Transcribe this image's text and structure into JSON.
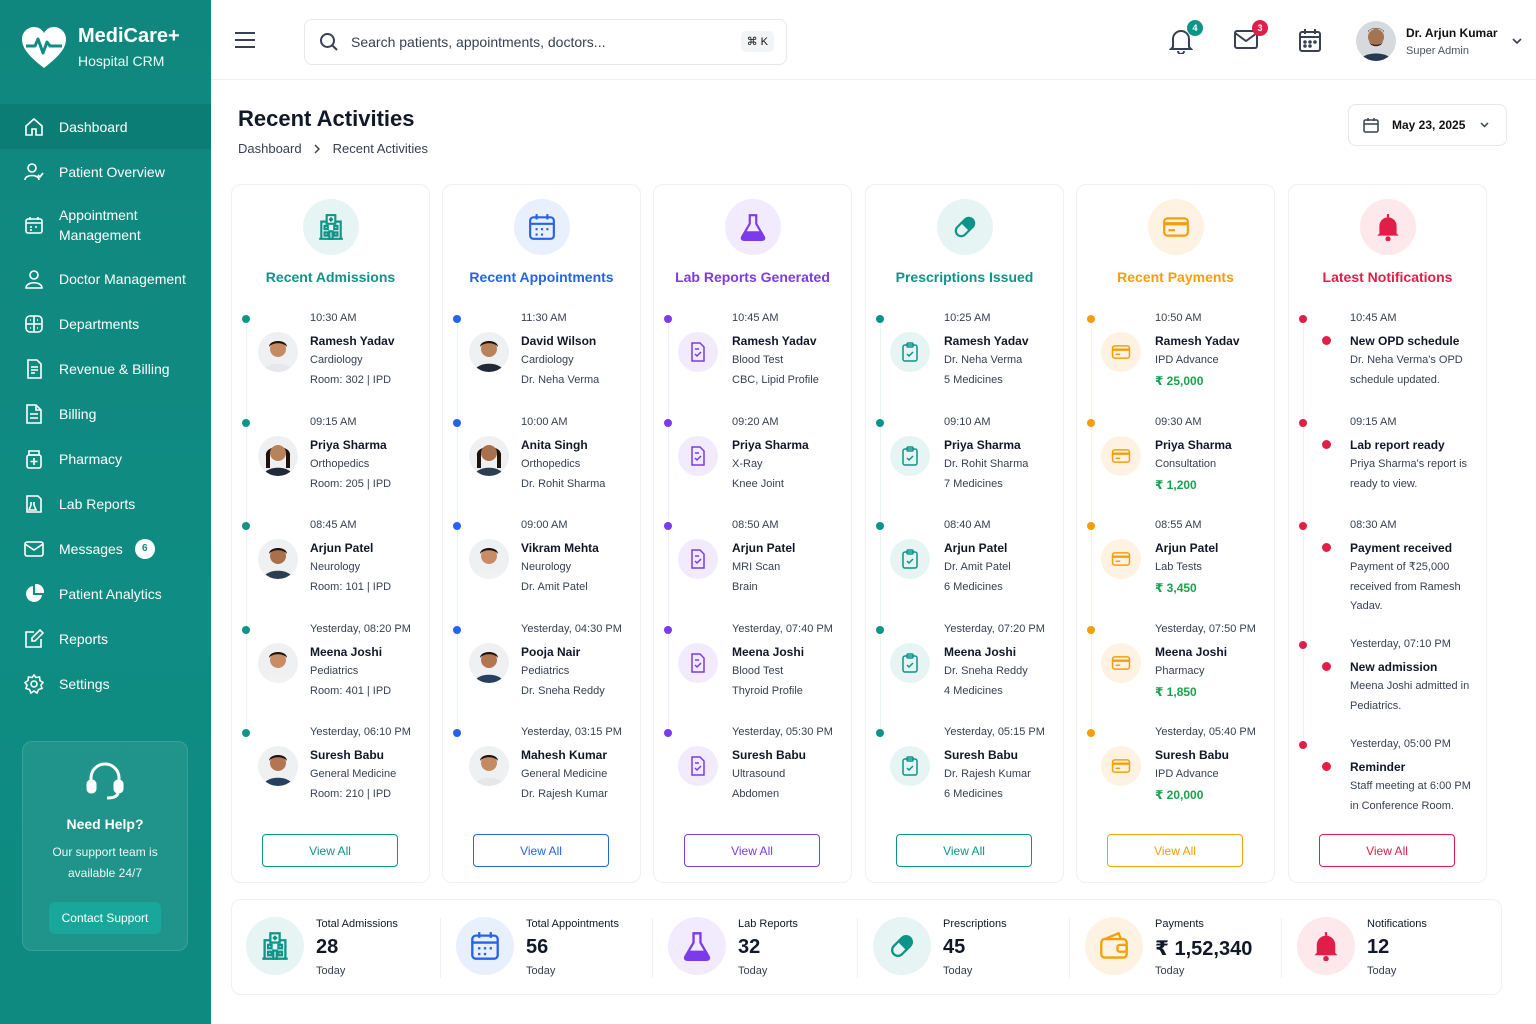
{
  "app": {
    "brand": "MediCare+",
    "subtitle": "Hospital CRM"
  },
  "nav": [
    {
      "label": "Dashboard",
      "icon": "home-icon",
      "active": true
    },
    {
      "label": "Patient Overview",
      "icon": "users-icon"
    },
    {
      "label": "Appointment Management",
      "icon": "calendar-icon"
    },
    {
      "label": "Doctor Management",
      "icon": "user-icon"
    },
    {
      "label": "Departments",
      "icon": "grid-icon"
    },
    {
      "label": "Revenue & Billing",
      "icon": "receipt-icon"
    },
    {
      "label": "Billing",
      "icon": "document-icon"
    },
    {
      "label": "Pharmacy",
      "icon": "pharmacy-icon"
    },
    {
      "label": "Lab Reports",
      "icon": "lab-icon"
    },
    {
      "label": "Messages",
      "icon": "mail-icon",
      "badge": "6"
    },
    {
      "label": "Patient Analytics",
      "icon": "pie-chart-icon"
    },
    {
      "label": "Reports",
      "icon": "edit-report-icon"
    },
    {
      "label": "Settings",
      "icon": "gear-icon"
    }
  ],
  "help": {
    "title": "Need Help?",
    "desc": "Our support team is available 24/7",
    "button": "Contact Support"
  },
  "header": {
    "search_placeholder": "Search patients, appointments, doctors...",
    "shortcut": "⌘ K",
    "notif_count": "4",
    "mail_count": "3",
    "user_name": "Dr. Arjun Kumar",
    "user_role": "Super Admin"
  },
  "page": {
    "title": "Recent Activities",
    "crumb_root": "Dashboard",
    "crumb_current": "Recent Activities",
    "date": "May 23, 2025"
  },
  "colors": {
    "admissions": "#0f9488",
    "appointments": "#2563eb",
    "lab": "#7c3aed",
    "prescriptions": "#0d9488",
    "payments": "#f59e0b",
    "notifications": "#e11d48"
  },
  "cards": [
    {
      "title": "Recent Admissions",
      "color": "#0f9488",
      "tint": "#e6f5f3",
      "icon": "hospital-icon",
      "view_all": "View All",
      "items": [
        {
          "time": "10:30 AM",
          "name": "Ramesh Yadav",
          "l1": "Cardiology",
          "l2": "Room: 302 | IPD"
        },
        {
          "time": "09:15 AM",
          "name": "Priya Sharma",
          "l1": "Orthopedics",
          "l2": "Room: 205 | IPD"
        },
        {
          "time": "08:45 AM",
          "name": "Arjun Patel",
          "l1": "Neurology",
          "l2": "Room: 101 | IPD"
        },
        {
          "time": "Yesterday, 08:20 PM",
          "name": "Meena Joshi",
          "l1": "Pediatrics",
          "l2": "Room: 401 | IPD"
        },
        {
          "time": "Yesterday, 06:10 PM",
          "name": "Suresh Babu",
          "l1": "General Medicine",
          "l2": "Room: 210 | IPD"
        }
      ]
    },
    {
      "title": "Recent Appointments",
      "color": "#2563eb",
      "tint": "#e8f0fe",
      "icon": "calendar-icon",
      "view_all": "View All",
      "items": [
        {
          "time": "11:30 AM",
          "name": "David Wilson",
          "l1": "Cardiology",
          "l2": "Dr. Neha Verma"
        },
        {
          "time": "10:00 AM",
          "name": "Anita Singh",
          "l1": "Orthopedics",
          "l2": "Dr. Rohit Sharma"
        },
        {
          "time": "09:00 AM",
          "name": "Vikram Mehta",
          "l1": "Neurology",
          "l2": "Dr. Amit Patel"
        },
        {
          "time": "Yesterday, 04:30 PM",
          "name": "Pooja Nair",
          "l1": "Pediatrics",
          "l2": "Dr. Sneha Reddy"
        },
        {
          "time": "Yesterday, 03:15 PM",
          "name": "Mahesh Kumar",
          "l1": "General Medicine",
          "l2": "Dr. Rajesh Kumar"
        }
      ]
    },
    {
      "title": "Lab Reports Generated",
      "color": "#7c3aed",
      "tint": "#f1ebfd",
      "icon": "flask-icon",
      "view_all": "View All",
      "items": [
        {
          "time": "10:45 AM",
          "name": "Ramesh Yadav",
          "l1": "Blood Test",
          "l2": "CBC, Lipid Profile"
        },
        {
          "time": "09:20 AM",
          "name": "Priya Sharma",
          "l1": "X-Ray",
          "l2": "Knee Joint"
        },
        {
          "time": "08:50 AM",
          "name": "Arjun Patel",
          "l1": "MRI Scan",
          "l2": "Brain"
        },
        {
          "time": "Yesterday, 07:40 PM",
          "name": "Meena Joshi",
          "l1": "Blood Test",
          "l2": "Thyroid Profile"
        },
        {
          "time": "Yesterday, 05:30 PM",
          "name": "Suresh Babu",
          "l1": "Ultrasound",
          "l2": "Abdomen"
        }
      ]
    },
    {
      "title": "Prescriptions Issued",
      "color": "#0d9488",
      "tint": "#e6f5f3",
      "icon": "pill-icon",
      "view_all": "View All",
      "items": [
        {
          "time": "10:25 AM",
          "name": "Ramesh Yadav",
          "l1": "Dr. Neha Verma",
          "l2": "5 Medicines"
        },
        {
          "time": "09:10 AM",
          "name": "Priya Sharma",
          "l1": "Dr. Rohit Sharma",
          "l2": "7 Medicines"
        },
        {
          "time": "08:40 AM",
          "name": "Arjun Patel",
          "l1": "Dr. Amit Patel",
          "l2": "6 Medicines"
        },
        {
          "time": "Yesterday, 07:20 PM",
          "name": "Meena Joshi",
          "l1": "Dr. Sneha Reddy",
          "l2": "4 Medicines"
        },
        {
          "time": "Yesterday, 05:15 PM",
          "name": "Suresh Babu",
          "l1": "Dr. Rajesh Kumar",
          "l2": "6 Medicines"
        }
      ]
    },
    {
      "title": "Recent Payments",
      "color": "#f59e0b",
      "tint": "#fef3e2",
      "icon": "card-icon",
      "view_all": "View All",
      "items": [
        {
          "time": "10:50 AM",
          "name": "Ramesh Yadav",
          "l1": "IPD Advance",
          "amount": "₹ 25,000"
        },
        {
          "time": "09:30 AM",
          "name": "Priya Sharma",
          "l1": "Consultation",
          "amount": "₹ 1,200"
        },
        {
          "time": "08:55 AM",
          "name": "Arjun Patel",
          "l1": "Lab Tests",
          "amount": "₹ 3,450"
        },
        {
          "time": "Yesterday, 07:50 PM",
          "name": "Meena Joshi",
          "l1": "Pharmacy",
          "amount": "₹ 1,850"
        },
        {
          "time": "Yesterday, 05:40 PM",
          "name": "Suresh Babu",
          "l1": "IPD Advance",
          "amount": "₹ 20,000"
        }
      ]
    },
    {
      "title": "Latest Notifications",
      "color": "#e11d48",
      "tint": "#fde8ec",
      "icon": "bell-icon",
      "view_all": "View All",
      "items": [
        {
          "time": "10:45 AM",
          "name": "New OPD schedule",
          "desc": "Dr. Neha Verma's OPD schedule updated."
        },
        {
          "time": "09:15 AM",
          "name": "Lab report ready",
          "desc": "Priya Sharma's report is ready to view."
        },
        {
          "time": "08:30 AM",
          "name": "Payment received",
          "desc": "Payment of ₹25,000 received from Ramesh Yadav."
        },
        {
          "time": "Yesterday, 07:10 PM",
          "name": "New admission",
          "desc": "Meena Joshi admitted in Pediatrics."
        },
        {
          "time": "Yesterday, 05:00 PM",
          "name": "Reminder",
          "desc": "Staff meeting at 6:00 PM in Conference Room."
        }
      ]
    }
  ],
  "stats": [
    {
      "label": "Total Admissions",
      "value": "28",
      "sub": "Today",
      "icon": "hospital-icon",
      "color": "#0f9488",
      "tint": "#e6f5f3"
    },
    {
      "label": "Total Appointments",
      "value": "56",
      "sub": "Today",
      "icon": "calendar-icon",
      "color": "#2563eb",
      "tint": "#e8f0fe"
    },
    {
      "label": "Lab Reports",
      "value": "32",
      "sub": "Today",
      "icon": "flask-icon",
      "color": "#7c3aed",
      "tint": "#f1ebfd"
    },
    {
      "label": "Prescriptions",
      "value": "45",
      "sub": "Today",
      "icon": "pill-icon",
      "color": "#0d9488",
      "tint": "#e6f5f3"
    },
    {
      "label": "Payments",
      "value": "₹ 1,52,340",
      "sub": "Today",
      "icon": "wallet-icon",
      "color": "#f59e0b",
      "tint": "#fef3e2"
    },
    {
      "label": "Notifications",
      "value": "12",
      "sub": "Today",
      "icon": "bell-icon",
      "color": "#e11d48",
      "tint": "#fde8ec"
    }
  ]
}
